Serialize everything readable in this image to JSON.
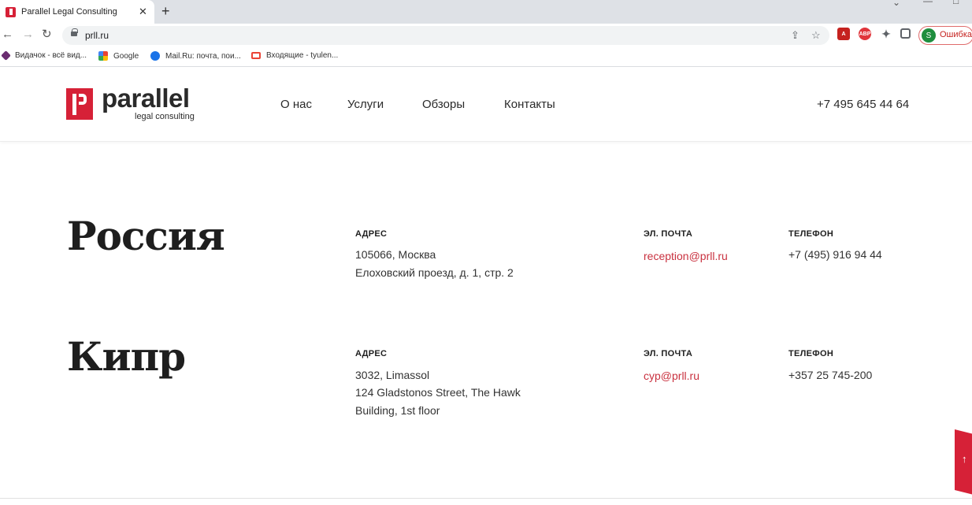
{
  "browser": {
    "tab_title": "Parallel Legal Consulting",
    "url": "prll.ru",
    "profile_label": "Ошибка",
    "profile_initial": "S",
    "bookmarks": [
      {
        "label": "Видачок - всё вид..."
      },
      {
        "label": "Google"
      },
      {
        "label": "Mail.Ru: почта, пои..."
      },
      {
        "label": "Входящие - tyulen..."
      }
    ]
  },
  "header": {
    "logo_word": "parallel",
    "logo_sub": "legal consulting",
    "nav": [
      "О нас",
      "Услуги",
      "Обзоры",
      "Контакты"
    ],
    "phone": "+7 495 645 44 64"
  },
  "offices": [
    {
      "country": "Россия",
      "address_label": "АДРЕС",
      "address_lines": [
        "105066, Москва",
        "Елоховский проезд, д. 1, стр. 2"
      ],
      "email_label": "ЭЛ. ПОЧТА",
      "email": "reception@prll.ru",
      "phone_label": "ТЕЛЕФОН",
      "phone": "+7 (495) 916 94 44"
    },
    {
      "country": "Кипр",
      "address_label": "АДРЕС",
      "address_lines": [
        "3032, Limassol",
        "124 Gladstonos Street, The Hawk",
        "Building, 1st floor"
      ],
      "email_label": "ЭЛ. ПОЧТА",
      "email": "cyp@prll.ru",
      "phone_label": "ТЕЛЕФОН",
      "phone": "+357 25 745-200"
    }
  ],
  "colors": {
    "brand_red": "#d62137",
    "email_red": "#c9313f",
    "text_dark": "#1e1e1e"
  }
}
